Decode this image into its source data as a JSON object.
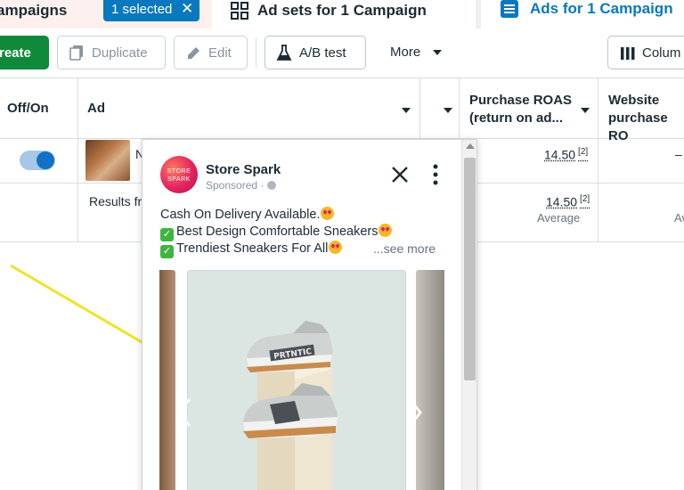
{
  "tabs": {
    "campaigns_label": "ampaigns",
    "selected_pill": "1 selected",
    "adsets_label": "Ad sets for 1 Campaign",
    "ads_label": "Ads for 1 Campaign"
  },
  "toolbar": {
    "create": "reate",
    "duplicate": "Duplicate",
    "edit": "Edit",
    "ab_test": "A/B test",
    "more": "More",
    "columns": "Colum"
  },
  "table": {
    "headers": {
      "off_on": "Off/On",
      "ad": "Ad",
      "roas_line1": "Purchase ROAS",
      "roas_line2": "(return on ad...",
      "website_line1": "Website",
      "website_line2": "purchase RO"
    },
    "rows": [
      {
        "ad_letter": "N",
        "roas": "14.50",
        "roas_sup": "[2]",
        "website": ""
      },
      {
        "summary": "Results fr",
        "roas": "14.50",
        "roas_sup": "[2]",
        "roas_sub": "Average",
        "website_sub": "Av"
      }
    ]
  },
  "preview": {
    "avatar_text": "STORE SPARK",
    "store_name": "Store Spark",
    "sponsored": "Sponsored ·",
    "line1": "Cash On Delivery Available.",
    "line2": "Best Design Comfortable Sneakers",
    "line3": "Trendiest Sneakers For All",
    "see_more": "...see more",
    "shoe_brand": "PRTNTIC"
  },
  "colors": {
    "accent": "#0a78be",
    "create_green": "#0f8a3a",
    "arrow_yellow": "#f2e227"
  }
}
